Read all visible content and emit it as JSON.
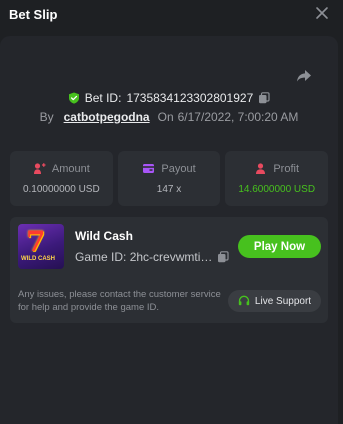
{
  "header": {
    "title": "Bet Slip"
  },
  "bet": {
    "id_label": "Bet ID:",
    "id": "173583412330280192​7",
    "by_label": "By",
    "user": "catbotpegodna",
    "on_label": "On",
    "datetime": "6/17/2022, 7:00:20 AM"
  },
  "stats": [
    {
      "label": "Amount",
      "value": "0.10000000 USD",
      "icon": "amount-icon",
      "color": "#e84a5f"
    },
    {
      "label": "Payout",
      "value": "147 x",
      "icon": "payout-icon",
      "color": "#a855f7"
    },
    {
      "label": "Profit",
      "value": "14.6000000 USD",
      "icon": "profit-icon",
      "color": "#e84a5f"
    }
  ],
  "game": {
    "name": "Wild Cash",
    "id_label": "Game ID:",
    "id_value": "2hc-crevwmti-1...",
    "thumb_text": "WILD CASH",
    "play_label": "Play Now",
    "notice": "Any issues, please contact the customer service for help and provide the game ID.",
    "support_label": "Live Support"
  },
  "colors": {
    "accent_green": "#47c11e",
    "background": "#1e2023",
    "panel": "#24262b",
    "card": "#2c2f34"
  }
}
